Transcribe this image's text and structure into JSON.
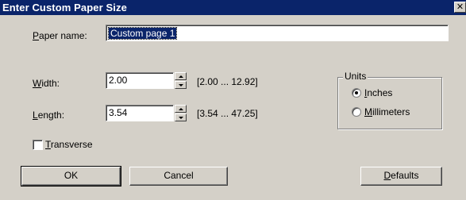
{
  "dialog": {
    "title": "Enter Custom Paper Size",
    "close_glyph": "✕"
  },
  "paper_name": {
    "label_prefix": "",
    "label_hotkey": "P",
    "label_rest": "aper name:",
    "value": "Custom page 1"
  },
  "width": {
    "label_hotkey": "W",
    "label_rest": "idth:",
    "value": "2.00",
    "range": "[2.00 ... 12.92]"
  },
  "length": {
    "label_hotkey": "L",
    "label_rest": "ength:",
    "value": "3.54",
    "range": "[3.54 ... 47.25]"
  },
  "transverse": {
    "label_hotkey": "T",
    "label_rest": "ransverse",
    "checked": false
  },
  "units": {
    "title": "Units",
    "options": [
      {
        "hotkey": "I",
        "rest": "nches",
        "selected": true
      },
      {
        "hotkey": "M",
        "rest": "illimeters",
        "selected": false
      }
    ]
  },
  "buttons": {
    "ok": "OK",
    "cancel": "Cancel",
    "defaults_hotkey": "D",
    "defaults_rest": "efaults"
  },
  "colors": {
    "titlebar": "#0a246a",
    "face": "#d4d0c8",
    "selection": "#0a246a"
  }
}
